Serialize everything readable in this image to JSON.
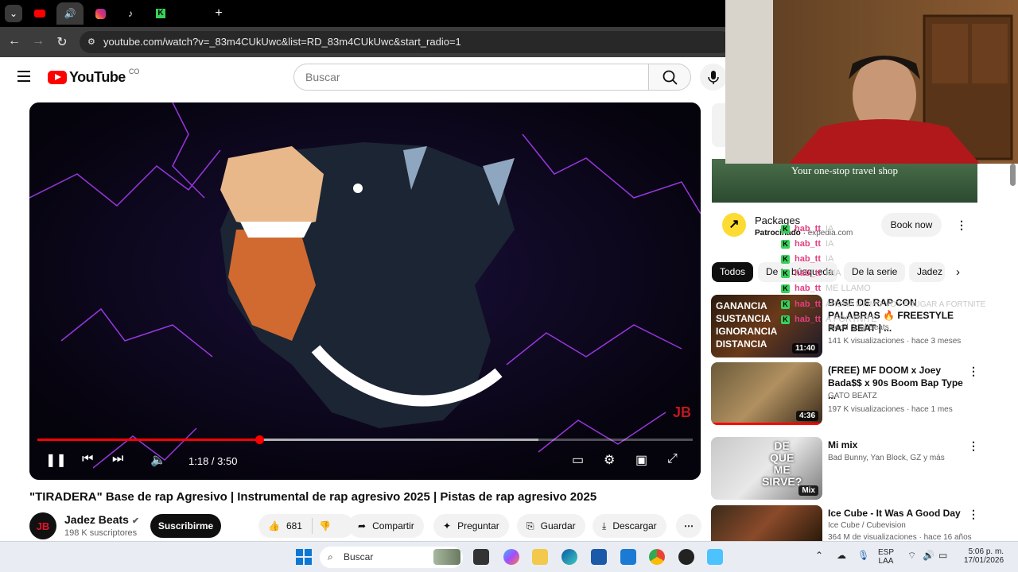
{
  "browser": {
    "url": "youtube.com/watch?v=_83m4CUkUwc&list=RD_83m4CUkUwc&start_radio=1",
    "tab_icons": [
      "chevron-down-icon",
      "youtube-icon",
      "speaker-icon",
      "instagram-icon",
      "tiktok-icon",
      "kick-icon",
      "blank-tab"
    ]
  },
  "header": {
    "logo_text": "YouTube",
    "country": "CO",
    "search_placeholder": "Buscar"
  },
  "player": {
    "time": "1:18 / 3:50",
    "progress_fraction": 0.339,
    "buffered_fraction": 0.765,
    "watermark": "JB"
  },
  "video": {
    "title": "\"TIRADERA\" Base de rap Agresivo | Instrumental de rap agresivo 2025 | Pistas de rap agresivo 2025",
    "channel_name": "Jadez Beats",
    "channel_avatar": "JB",
    "subscribers": "198 K suscriptores",
    "subscribe_label": "Suscribirme",
    "likes": "681",
    "share_label": "Compartir",
    "ask_label": "Preguntar",
    "save_label": "Guardar",
    "download_label": "Descargar"
  },
  "ad": {
    "banner_text": "Your one-stop travel shop",
    "title": "Packages",
    "sponsored": "Patrocinado",
    "domain": "expedia.com",
    "cta": "Book now"
  },
  "chips": [
    "Todos",
    "De tu búsqueda",
    "De la serie",
    "Jadez"
  ],
  "chat_overlay": [
    {
      "user": "hab_tt",
      "msg": "IA"
    },
    {
      "user": "hab_tt",
      "msg": "IA"
    },
    {
      "user": "hab_tt",
      "msg": "IA"
    },
    {
      "user": "hab_tt",
      "msg": "MIA"
    },
    {
      "user": "hab_tt",
      "msg": "ME LLAMO"
    },
    {
      "user": "hab_tt",
      "msg": "AHORA MISMO VOY A JUGAR A FORTNITE"
    },
    {
      "user": "hab_tt",
      "msg": "A FORTNITE"
    }
  ],
  "related": [
    {
      "title": "BASE DE RAP CON PALABRAS 🔥 FREESTYLE RAP BEAT | ...",
      "channel": "Blood Soul Beats",
      "meta": "141 K visualizaciones · hace 3 meses",
      "duration": "11:40",
      "thumb_text": "GANANCIA\nSUSTANCIA\nIGNORANCIA\nDISTANCIA"
    },
    {
      "title": "(FREE) MF DOOM x Joey Bada$$ x 90s Boom Bap Type ...",
      "channel": "GATO BEATZ",
      "meta": "197 K visualizaciones · hace 1 mes",
      "duration": "4:36",
      "thumb_text": ""
    },
    {
      "title": "Mi mix",
      "channel": "Bad Bunny, Yan Block, GZ y más",
      "meta": "",
      "duration": "Mix",
      "thumb_text": "DE\nQUE\nME\nSIRVE?"
    },
    {
      "title": "Ice Cube - It Was A Good Day",
      "channel": "Ice Cube / Cubevision",
      "meta": "364 M de visualizaciones · hace 16 años",
      "duration": "",
      "thumb_text": ""
    }
  ],
  "taskbar": {
    "search_label": "Buscar",
    "lang_top": "ESP",
    "lang_bottom": "LAA",
    "time": "5:06 p. m.",
    "date": "17/01/2026"
  },
  "colors": {
    "youtube_red": "#ff0000",
    "progress_red": "#ff0000",
    "chat_user": "#e04080",
    "kick_green": "#38d15a"
  }
}
